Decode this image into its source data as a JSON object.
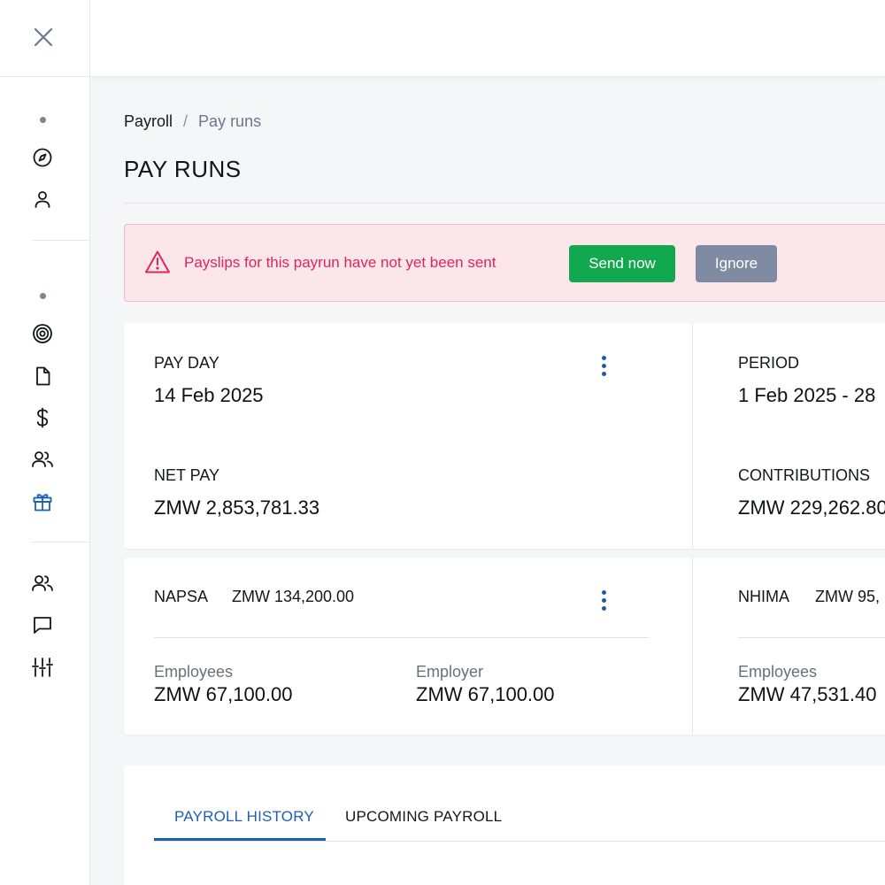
{
  "breadcrumb": {
    "root": "Payroll",
    "separator": "/",
    "current": "Pay runs"
  },
  "page_title": "PAY RUNS",
  "alert": {
    "message": "Payslips for this payrun have not yet been sent",
    "send_label": "Send now",
    "ignore_label": "Ignore",
    "icon": "warning-triangle-icon"
  },
  "summary": {
    "pay_day_label": "PAY DAY",
    "pay_day_value": "14 Feb 2025",
    "net_pay_label": "NET PAY",
    "net_pay_value": "ZMW 2,853,781.33",
    "period_label": "PERIOD",
    "period_value": "1 Feb 2025 - 28",
    "contributions_label": "CONTRIBUTIONS",
    "contributions_value": "ZMW 229,262.80"
  },
  "napsa": {
    "label": "NAPSA",
    "total": "ZMW 134,200.00",
    "employees_label": "Employees",
    "employees_value": "ZMW 67,100.00",
    "employer_label": "Employer",
    "employer_value": "ZMW 67,100.00"
  },
  "nhima": {
    "label": "NHIMA",
    "total": "ZMW 95,",
    "employees_label": "Employees",
    "employees_value": "ZMW 47,531.40"
  },
  "tabs": [
    {
      "label": "PAYROLL HISTORY",
      "active": true
    },
    {
      "label": "UPCOMING PAYROLL",
      "active": false
    }
  ],
  "sidebar": {
    "icons": [
      "close-icon",
      "compass-icon",
      "user-icon",
      "target-icon",
      "document-icon",
      "dollar-icon",
      "team-icon",
      "gift-icon",
      "people-icon",
      "chat-icon",
      "sliders-icon"
    ]
  },
  "colors": {
    "accent": "#1d5fb0",
    "alert_bg": "#fbe7ea",
    "alert_text": "#e0245e",
    "success": "#12a84f",
    "neutral_button": "#7f8aa3"
  }
}
